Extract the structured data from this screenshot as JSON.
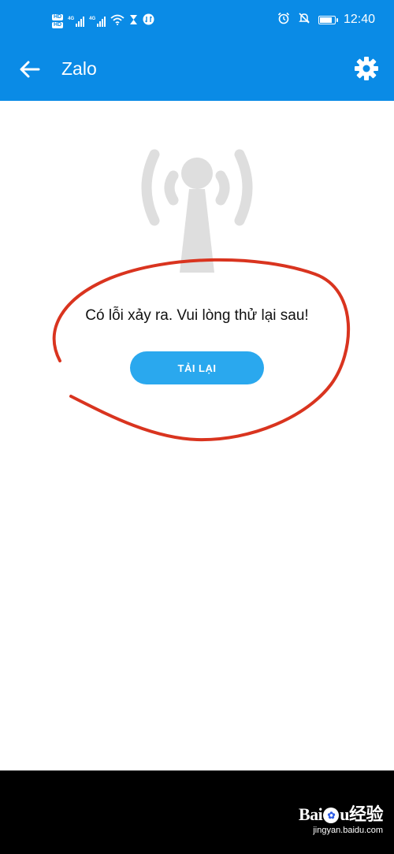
{
  "status_bar": {
    "hd_badges": [
      "HD",
      "HD"
    ],
    "network_labels": [
      "4G",
      "4G"
    ],
    "icons": [
      "hd-icon",
      "signal-icon",
      "signal-icon",
      "wifi-icon",
      "hourglass-icon",
      "data-saver-icon",
      "alarm-icon",
      "mute-icon",
      "battery-icon"
    ],
    "battery_level_percent": 90,
    "time": "12:40"
  },
  "app_bar": {
    "title": "Zalo",
    "back_icon": "arrow-left-icon",
    "settings_icon": "gear-icon"
  },
  "content": {
    "illustration_icon": "broadcast-antenna-icon",
    "error_message": "Có lỗi xảy ra. Vui lòng thử lại sau!",
    "reload_button_label": "TẢI LẠI"
  },
  "watermark": {
    "logo_text": "Baidu经验",
    "url": "jingyan.baidu.com"
  },
  "colors": {
    "header_blue": "#0a8be6",
    "button_blue": "#2aa8ee",
    "annotation_red": "#d9341f",
    "illustration_gray": "#dedede"
  }
}
